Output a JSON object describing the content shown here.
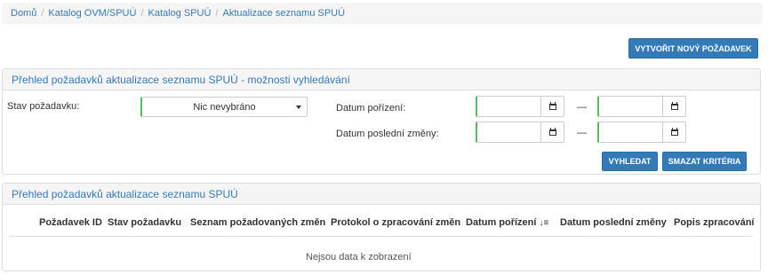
{
  "breadcrumb": {
    "items": [
      "Domů",
      "Katalog OVM/SPUÚ",
      "Katalog SPUÚ",
      "Aktualizace seznamu SPUÚ"
    ],
    "separator": "/"
  },
  "actions": {
    "new_request_label": "VYTVOŘIT NOVÝ POŽADAVEK"
  },
  "search_panel": {
    "title": "Přehled požadavků aktualizace seznamu SPUÚ - možnosti vyhledávání",
    "status_label": "Stav požadavku:",
    "status_value": "Nic nevybráno",
    "date_acquired_label": "Datum pořízení:",
    "date_changed_label": "Datum poslední změny:",
    "range_dash": "—",
    "search_label": "VYHLEDAT",
    "clear_label": "SMAZAT KRITÉRIA",
    "calendar_icon": "calendar-icon"
  },
  "results_panel": {
    "title": "Přehled požadavků aktualizace seznamu SPUÚ",
    "columns": [
      "Požadavek ID",
      "Stav požadavku",
      "Seznam požadovaných změn",
      "Protokol o zpracování změn",
      "Datum pořízení",
      "Datum poslední změny",
      "Popis zpracování"
    ],
    "sort_icon": "sort-desc-icon",
    "empty_message": "Nejsou data k zobrazení"
  },
  "colors": {
    "primary": "#337ab7",
    "valid_border": "#5cb85c",
    "panel_heading_bg": "#f5f5f5"
  }
}
